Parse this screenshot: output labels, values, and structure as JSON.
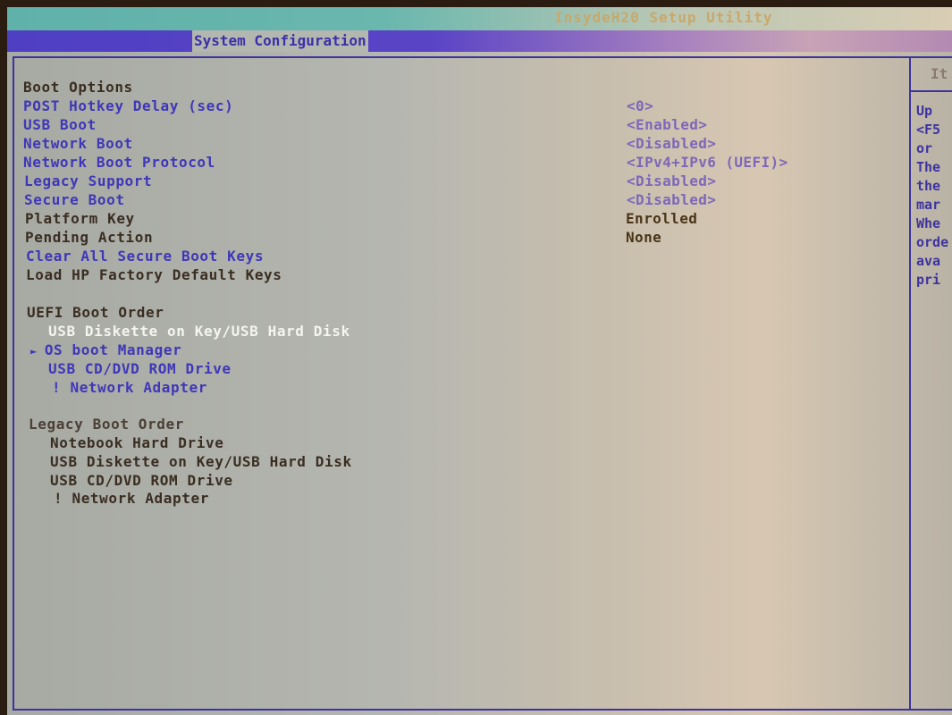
{
  "header": {
    "app_title": "InsydeH20 Setup Utility",
    "active_tab": "System Configuration"
  },
  "help_panel": {
    "header": "It",
    "lines": [
      "Up",
      "<F5",
      "or",
      "The",
      "the",
      "mar",
      "Whe",
      "orde",
      "ava",
      "pri"
    ]
  },
  "settings": {
    "section_title": "Boot Options",
    "items": [
      {
        "label": "POST Hotkey Delay (sec)",
        "value": "<0>"
      },
      {
        "label": "USB Boot",
        "value": "<Enabled>"
      },
      {
        "label": "Network Boot",
        "value": "<Disabled>"
      },
      {
        "label": "Network Boot Protocol",
        "value": "<IPv4+IPv6 (UEFI)>"
      },
      {
        "label": "Legacy Support",
        "value": "<Disabled>"
      },
      {
        "label": "Secure Boot",
        "value": "<Disabled>"
      },
      {
        "label": "Platform Key",
        "value": "Enrolled"
      },
      {
        "label": "Pending Action",
        "value": "None"
      },
      {
        "label": "Clear All Secure Boot Keys",
        "value": ""
      },
      {
        "label": "Load HP Factory Default Keys",
        "value": ""
      }
    ]
  },
  "uefi_boot_order": {
    "title": "UEFI Boot Order",
    "items": [
      "USB Diskette on Key/USB Hard Disk",
      "OS boot Manager",
      "USB CD/DVD ROM Drive",
      "! Network Adapter"
    ],
    "pointer_glyph": "►"
  },
  "legacy_boot_order": {
    "title": "Legacy Boot Order",
    "items": [
      "Notebook Hard Drive",
      "USB Diskette on Key/USB Hard Disk",
      "USB CD/DVD ROM Drive",
      "! Network Adapter"
    ]
  },
  "colors": {
    "accent_blue": "#3f37b7",
    "value_purple": "#7e67b9",
    "title_gold": "#c9a86a"
  }
}
